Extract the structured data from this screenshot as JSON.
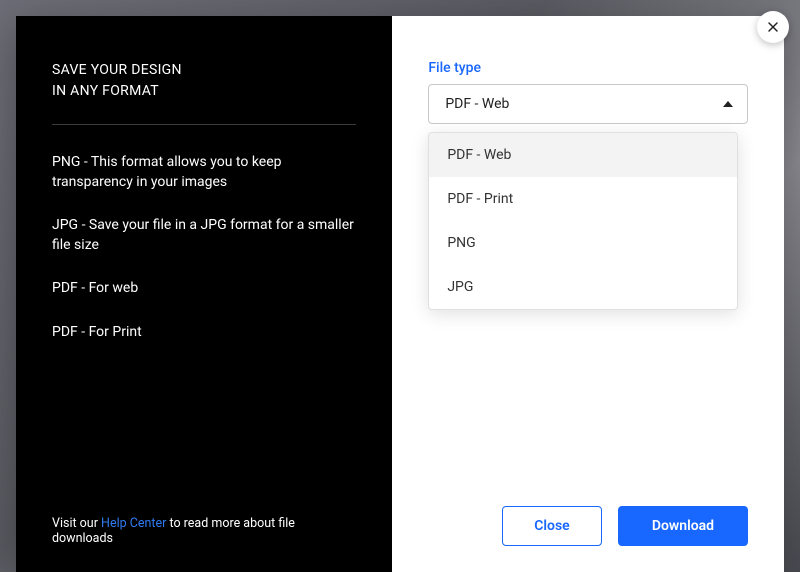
{
  "left": {
    "heading_line1": "SAVE YOUR DESIGN",
    "heading_line2": "IN ANY FORMAT",
    "formats": [
      "PNG - This format allows you to keep transparency in your images",
      "JPG - Save your file in a JPG format for a smaller file size",
      "PDF - For web",
      "PDF - For Print"
    ],
    "footer_prefix": "Visit our ",
    "footer_link": "Help Center",
    "footer_suffix": " to read more about file downloads"
  },
  "right": {
    "field_label": "File type",
    "selected_value": "PDF - Web",
    "options": [
      "PDF - Web",
      "PDF - Print",
      "PNG",
      "JPG"
    ],
    "close_label": "Close",
    "download_label": "Download"
  }
}
